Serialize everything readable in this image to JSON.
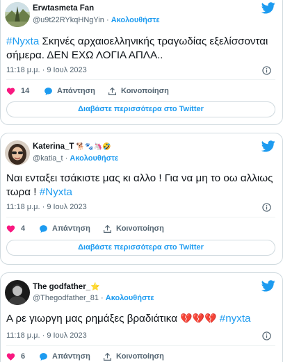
{
  "tweets": [
    {
      "display_name": "Erwtasmeta Fan",
      "handle": "@u9t22RYkqHNgYin",
      "follow_label": "Ακολουθήστε",
      "separator": "·",
      "hashtag": "#Nyxta",
      "text": " Σκηνές αρχαιοελληνικής τραγωδίας εξελίσσονται σήμερα. ΔΕΝ ΕΧΩ ΛΟΓΙΑ ΑΠΛΑ..",
      "timestamp": "11:18 μ.μ. · 9 Ιουλ 2023",
      "likes": "14",
      "reply_label": "Απάντηση",
      "share_label": "Κοινοποίηση",
      "read_more_label": "Διαβάστε περισσότερα στο Twitter"
    },
    {
      "display_name": "Katerina_T",
      "display_emojis": "🐕🐾🦄🤣",
      "handle": "@katia_t",
      "follow_label": "Ακολουθήστε",
      "separator": "·",
      "text": "Ναι ενταξει τσάκιστε μας κι αλλο ! Για να μη το οω αλλιως τωρα ! ",
      "hashtag": "#Nyxta",
      "timestamp": "11:18 μ.μ. · 9 Ιουλ 2023",
      "likes": "4",
      "reply_label": "Απάντηση",
      "share_label": "Κοινοποίηση",
      "read_more_label": "Διαβάστε περισσότερα στο Twitter"
    },
    {
      "display_name": "The godfather_",
      "display_emojis": "⭐",
      "handle": "@Thegodfather_81",
      "follow_label": "Ακολουθήστε",
      "separator": "·",
      "text": "Α ρε γιωργη μας ρημάξες βραδιάτικα ",
      "text_emojis": "💔💔💔",
      "hashtag": "#nyxta",
      "timestamp": "11:18 μ.μ. · 9 Ιουλ 2023",
      "likes": "6",
      "reply_label": "Απάντηση",
      "share_label": "Κοινοποίηση"
    }
  ],
  "colors": {
    "accent": "#1d9bf0",
    "like": "#f91880",
    "muted": "#536471",
    "text": "#0f1419",
    "border": "#cfd9de"
  },
  "icons": [
    "twitter-bird-icon",
    "info-icon",
    "heart-icon",
    "reply-icon",
    "share-icon"
  ]
}
